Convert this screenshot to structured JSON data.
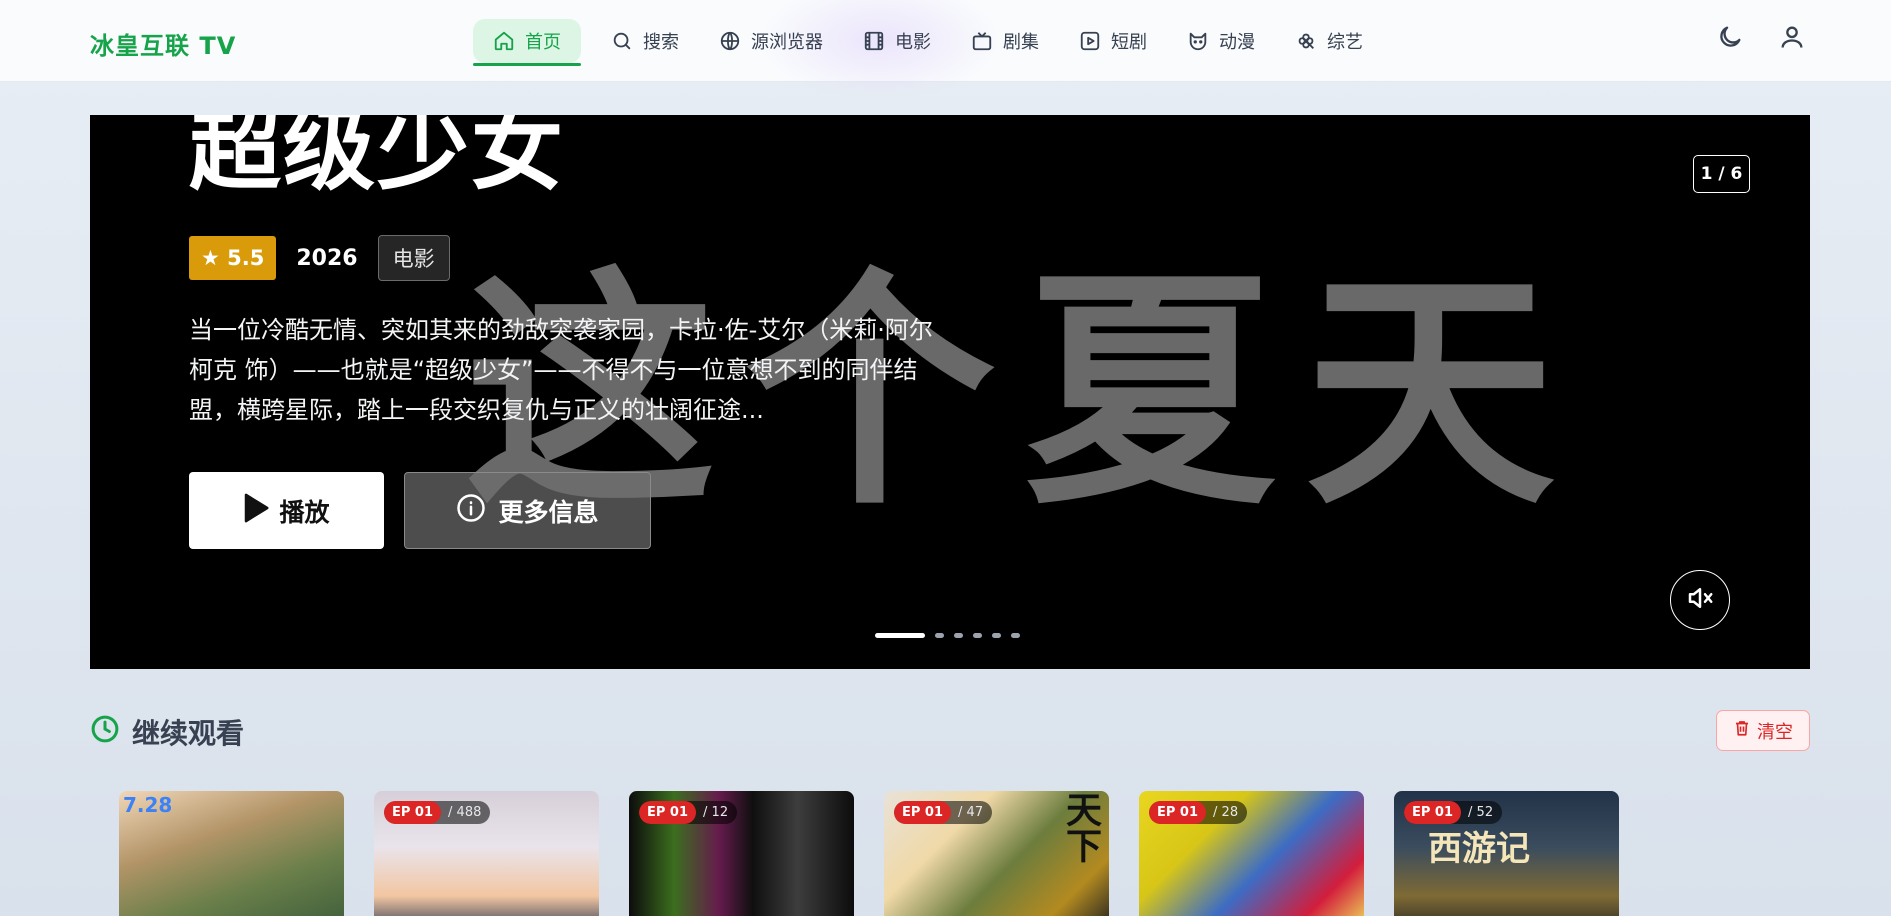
{
  "header": {
    "logo": "冰皇互联 TV",
    "nav": [
      {
        "label": "首页",
        "icon": "home-icon",
        "active": true
      },
      {
        "label": "搜索",
        "icon": "search-icon"
      },
      {
        "label": "源浏览器",
        "icon": "globe-icon"
      },
      {
        "label": "电影",
        "icon": "film-icon"
      },
      {
        "label": "剧集",
        "icon": "tv-icon"
      },
      {
        "label": "短剧",
        "icon": "play-square-icon"
      },
      {
        "label": "动漫",
        "icon": "cat-icon"
      },
      {
        "label": "综艺",
        "icon": "clover-icon"
      }
    ],
    "right": {
      "theme_icon": "moon-icon",
      "user_icon": "user-icon"
    }
  },
  "hero": {
    "title": "超级少女",
    "background_text": "这个夏天",
    "rating": "★ 5.5",
    "year": "2026",
    "type": "电影",
    "description": "当一位冷酷无情、突如其来的劲敌突袭家园，卡拉·佐-艾尔（米莉·阿尔柯克 饰）——也就是“超级少女”——不得不与一位意想不到的同伴结盟，横跨星际，踏上一段交织复仇与正义的壮阔征途...",
    "play_label": "播放",
    "info_label": "更多信息",
    "counter": "1 / 6",
    "slide_count": 6,
    "active_slide": 1
  },
  "continue_watching": {
    "title": "继续观看",
    "clear_label": "清空",
    "items": [
      {
        "ep": "",
        "total": "",
        "art_text": "7.28"
      },
      {
        "ep": "EP 01",
        "total": "/ 488",
        "art_text": ""
      },
      {
        "ep": "EP 01",
        "total": "/ 12",
        "art_text": ""
      },
      {
        "ep": "EP 01",
        "total": "/ 47",
        "art_text": "天下"
      },
      {
        "ep": "EP 01",
        "total": "/ 28",
        "art_text": ""
      },
      {
        "ep": "EP 01",
        "total": "/ 52",
        "art_text": "西游记"
      }
    ]
  },
  "colors": {
    "accent": "#16a34a",
    "rating": "#d99b0a",
    "danger": "#dc2626"
  }
}
